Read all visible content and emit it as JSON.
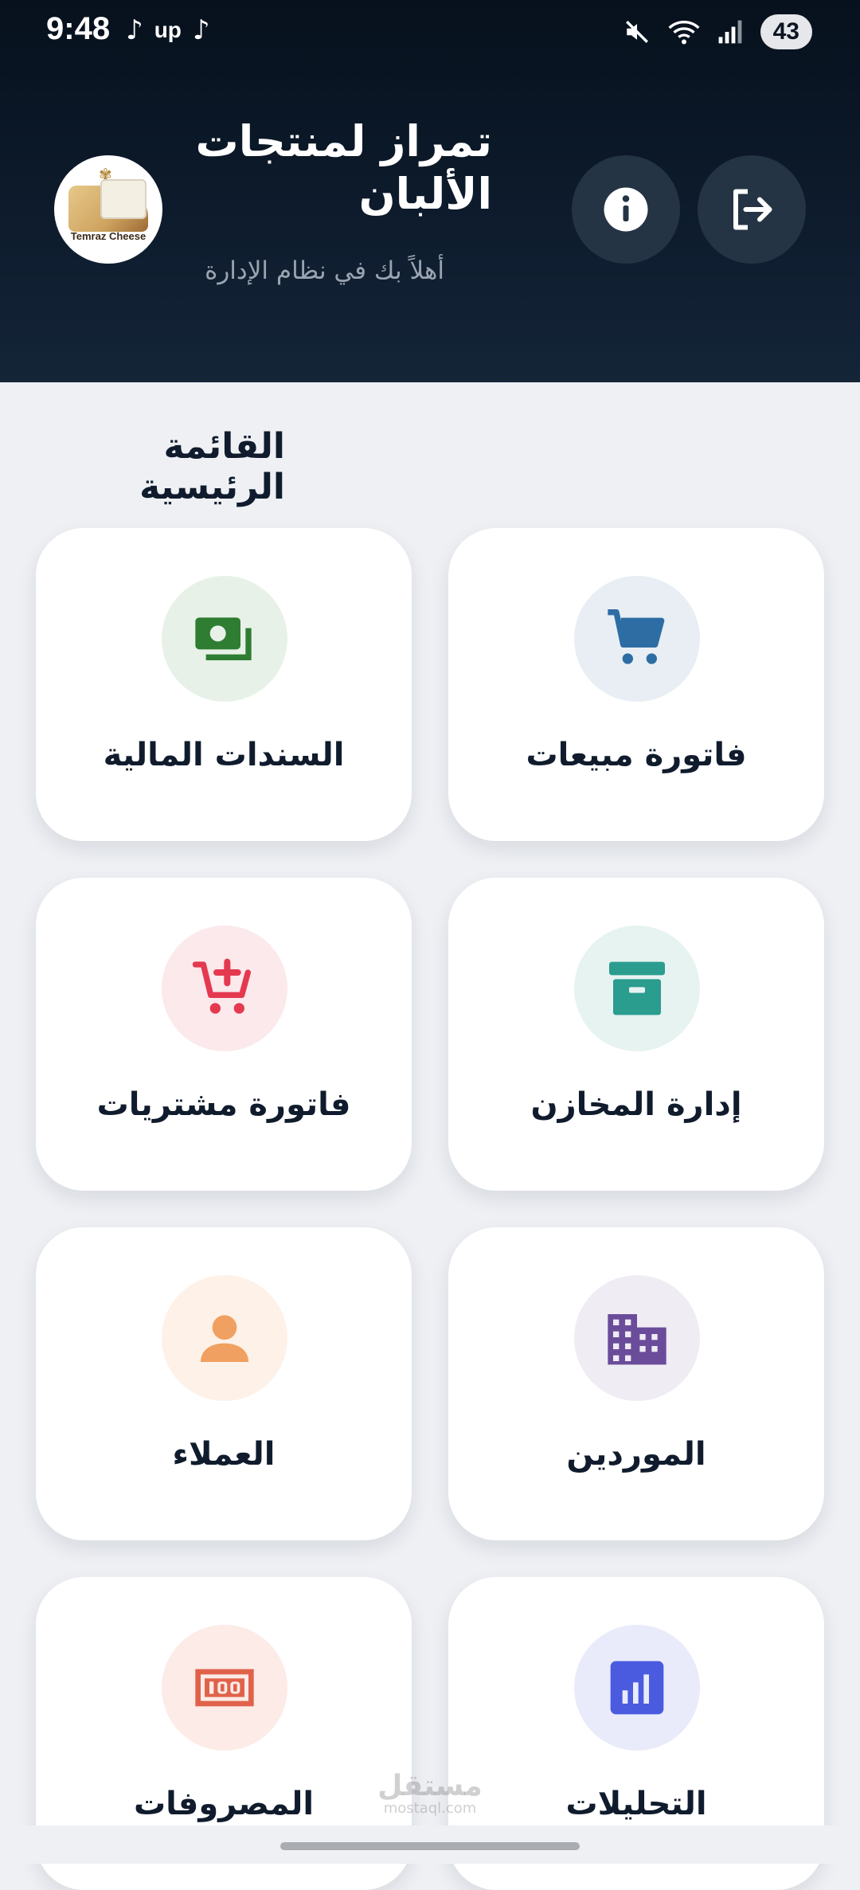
{
  "status_bar": {
    "time": "9:48",
    "left_icons": [
      "tiktok-icon",
      "up-icon",
      "tiktok-icon"
    ],
    "up_label": "up",
    "right_icons": [
      "mute-icon",
      "wifi-icon",
      "signal-icon"
    ],
    "battery": "43"
  },
  "header": {
    "logo_text": "Temraz Cheese",
    "title": "تمراز لمنتجات الألبان",
    "subtitle": "أهلاً بك في نظام الإدارة",
    "buttons": [
      {
        "icon": "info-icon"
      },
      {
        "icon": "logout-icon"
      }
    ]
  },
  "menu": {
    "title": "القائمة الرئيسية",
    "items": [
      {
        "label": "فاتورة مبيعات",
        "icon": "cart-icon",
        "icon_color": "#2e6da4",
        "bg": "#e8eef4"
      },
      {
        "label": "السندات المالية",
        "icon": "money-icon",
        "icon_color": "#2e7d32",
        "bg": "#e8f1e8"
      },
      {
        "label": "إدارة المخازن",
        "icon": "archive-box-icon",
        "icon_color": "#2a9d8f",
        "bg": "#e6f3f1"
      },
      {
        "label": "فاتورة مشتريات",
        "icon": "cart-add-icon",
        "icon_color": "#e53950",
        "bg": "#fbe9ec"
      },
      {
        "label": "الموردين",
        "icon": "building-icon",
        "icon_color": "#6b4c9a",
        "bg": "#efecf4"
      },
      {
        "label": "العملاء",
        "icon": "person-icon",
        "icon_color": "#f0a060",
        "bg": "#fdf1e8"
      },
      {
        "label": "التحليلات",
        "icon": "bar-chart-icon",
        "icon_color": "#4a5be0",
        "bg": "#e9ebfb"
      },
      {
        "label": "المصروفات",
        "icon": "banknote-100-icon",
        "icon_color": "#e0624a",
        "bg": "#fcebe7"
      }
    ]
  },
  "watermark": {
    "text": "مستقل",
    "sub": "mostaql.com"
  }
}
